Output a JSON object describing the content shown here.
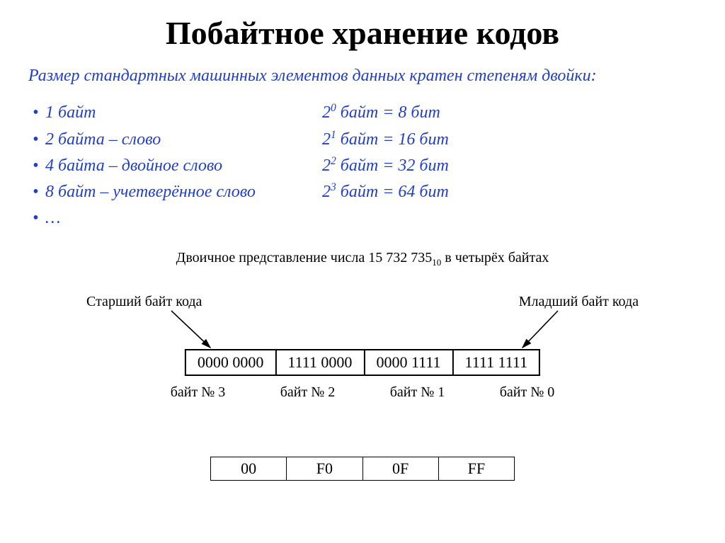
{
  "title": "Побайтное хранение кодов",
  "intro": "Размер стандартных машинных элементов данных кратен степеням двойки:",
  "left": {
    "b1": "1 байт",
    "b2": "2 байта – слово",
    "b3": "4 байта – двойное слово",
    "b4": "8 байт – учетверённое слово",
    "dots": "…"
  },
  "right": {
    "r1_pre": "2",
    "r1_sup": "0",
    "r1_post": " байт = 8 бит",
    "r2_pre": "2",
    "r2_sup": "1",
    "r2_post": " байт = 16 бит",
    "r3_pre": "2",
    "r3_sup": "2",
    "r3_post": " байт = 32 бит",
    "r4_pre": "2",
    "r4_sup": "3",
    "r4_post": " байт = 64 бит"
  },
  "midcap_pre": "Двоичное представление числа 15 732 735",
  "midcap_sub": "10",
  "midcap_post": " в четырёх байтах",
  "diagram": {
    "label_left": "Старший байт кода",
    "label_right": "Младший байт кода",
    "cells": {
      "c0": "0000 0000",
      "c1": "1111 0000",
      "c2": "0000 1111",
      "c3": "1111 1111"
    },
    "nums": {
      "n0": "байт № 3",
      "n1": "байт № 2",
      "n2": "байт № 1",
      "n3": "байт № 0"
    }
  },
  "hex": {
    "h0": "00",
    "h1": "F0",
    "h2": "0F",
    "h3": "FF"
  }
}
